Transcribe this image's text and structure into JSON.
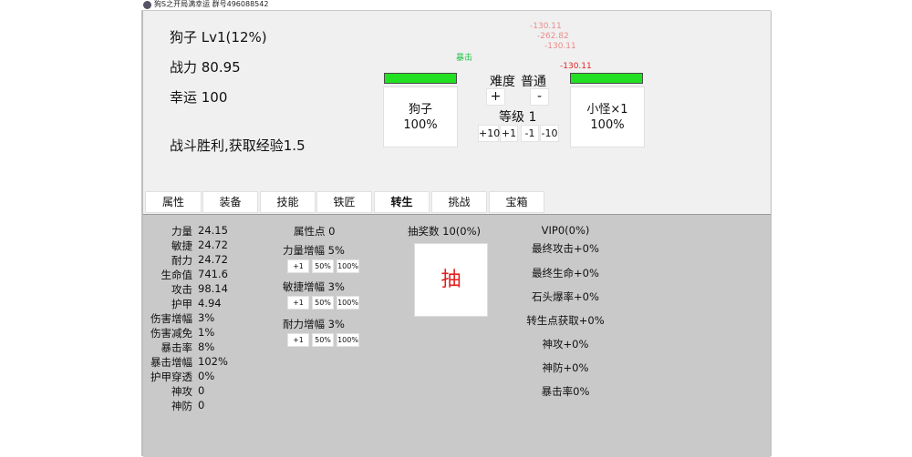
{
  "window": {
    "title": "狗S之开局满幸运 群号496088542"
  },
  "player": {
    "name_level": "狗子 Lv1(12%)",
    "power": "战力 80.95",
    "luck": "幸运 100",
    "battle_result": "战斗胜利,获取经验1.5"
  },
  "floaters": {
    "crit": "暴击",
    "dmg1": "-130.11",
    "dmg2": "-262.82",
    "dmg3": "-130.11",
    "dmg4": "-130.11"
  },
  "player_card": {
    "name": "狗子",
    "hp": "100%",
    "hp_fraction": 1.0
  },
  "enemy_card": {
    "name": "小怪×1",
    "hp": "100%",
    "hp_fraction": 1.0
  },
  "difficulty": {
    "label": "难度",
    "value": "普通",
    "plus": "+",
    "minus": "-"
  },
  "stage": {
    "label": "等级 1",
    "b1": "+10",
    "b2": "+1",
    "b3": "-1",
    "b4": "-10"
  },
  "tabs": [
    "属性",
    "装备",
    "技能",
    "铁匠",
    "转生",
    "挑战",
    "宝箱"
  ],
  "stats": [
    {
      "label": "力量",
      "value": "24.15"
    },
    {
      "label": "敏捷",
      "value": "24.72"
    },
    {
      "label": "耐力",
      "value": "24.72"
    },
    {
      "label": "生命值",
      "value": "741.6"
    },
    {
      "label": "攻击",
      "value": "98.14"
    },
    {
      "label": "护甲",
      "value": "4.94"
    },
    {
      "label": "伤害增幅",
      "value": "3%"
    },
    {
      "label": "伤害减免",
      "value": "1%"
    },
    {
      "label": "暴击率",
      "value": "8%"
    },
    {
      "label": "暴击增幅",
      "value": "102%"
    },
    {
      "label": "护甲穿透",
      "value": "0%"
    },
    {
      "label": "神攻",
      "value": "0"
    },
    {
      "label": "神防",
      "value": "0"
    }
  ],
  "attr_points": {
    "title": "属性点 0",
    "groups": [
      {
        "label": "力量增幅 5%",
        "b1": "+1",
        "b2": "50%",
        "b3": "100%"
      },
      {
        "label": "敏捷增幅 3%",
        "b1": "+1",
        "b2": "50%",
        "b3": "100%"
      },
      {
        "label": "耐力增幅 3%",
        "b1": "+1",
        "b2": "50%",
        "b3": "100%"
      }
    ]
  },
  "lottery": {
    "count": "抽奖数 10(0%)",
    "button": "抽"
  },
  "vip": [
    "VIP0(0%)",
    "最终攻击+0%",
    "最终生命+0%",
    "石头爆率+0%",
    "转生点获取+0%",
    "神攻+0%",
    "神防+0%",
    "暴击率0%"
  ],
  "colors": {
    "hp_green": "#22e022",
    "damage_red": "#e21e1e",
    "crit_green": "#24c24a",
    "panel_bg": "#c9c9c9"
  }
}
